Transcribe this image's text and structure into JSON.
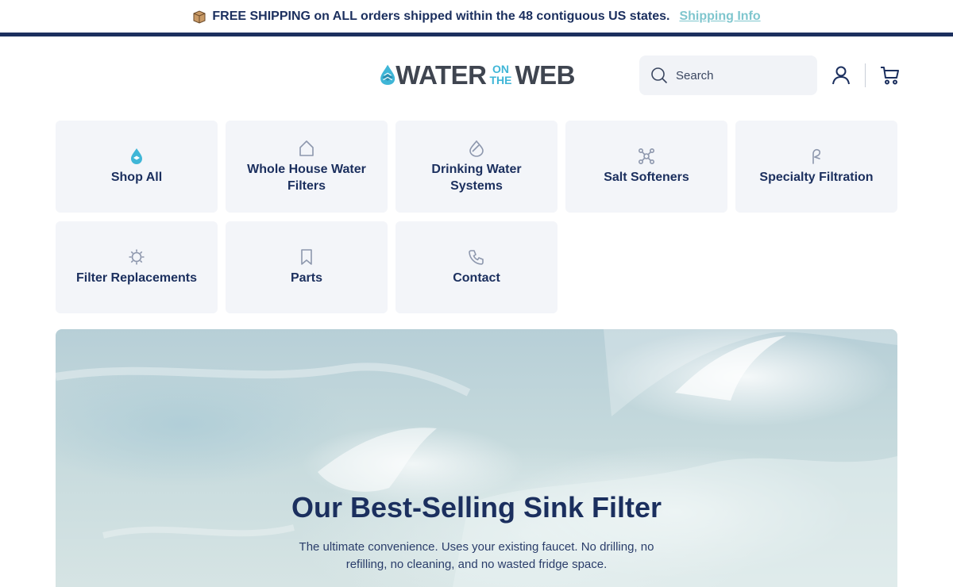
{
  "announcement": {
    "icon": "shipping-box-icon",
    "text": "FREE SHIPPING on ALL orders shipped within the 48 contiguous US states.",
    "link": "Shipping Info",
    "link_color": "#7fc6ce"
  },
  "header": {
    "logo": {
      "word1": "WATER",
      "on": "ON",
      "the": "THE",
      "word2": "WEB"
    },
    "search_placeholder": "Search",
    "icons": [
      "search-icon",
      "account-icon",
      "cart-icon"
    ]
  },
  "categories": [
    {
      "label": "Shop All",
      "icon": "water-drop-icon"
    },
    {
      "label": "Whole House Water Filters",
      "icon": "house-icon"
    },
    {
      "label": "Drinking Water Systems",
      "icon": "glass-icon"
    },
    {
      "label": "Salt Softeners",
      "icon": "molecule-icon"
    },
    {
      "label": "Specialty Filtration",
      "icon": "faucet-icon"
    },
    {
      "label": "Filter Replacements",
      "icon": "gear-icon"
    },
    {
      "label": "Parts",
      "icon": "bookmark-icon"
    },
    {
      "label": "Contact",
      "icon": "phone-icon"
    }
  ],
  "hero": {
    "title": "Our Best-Selling Sink Filter",
    "subtitle": "The ultimate convenience. Uses your existing faucet. No drilling, no refilling, no cleaning, and no wasted fridge space."
  },
  "colors": {
    "navy": "#1b2f5e",
    "accent": "#3fb6d7",
    "tile_bg": "#f3f5f9"
  }
}
